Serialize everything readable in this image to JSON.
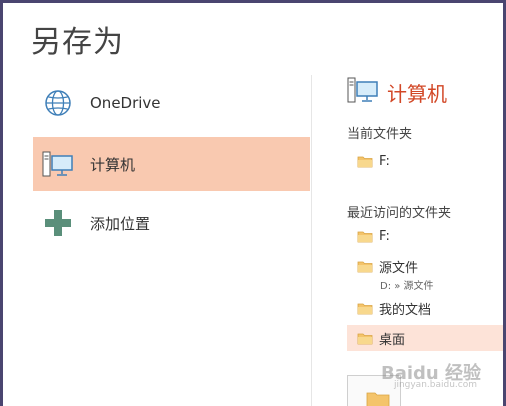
{
  "title": "另存为",
  "locations": [
    {
      "label": "OneDrive",
      "icon": "globe-icon"
    },
    {
      "label": "计算机",
      "icon": "computer-icon",
      "selected": true
    },
    {
      "label": "添加位置",
      "icon": "plus-icon"
    }
  ],
  "right": {
    "heading": "计算机",
    "current_folder_title": "当前文件夹",
    "current_folder": "F:",
    "recent_title": "最近访问的文件夹",
    "recent": [
      {
        "name": "F:"
      },
      {
        "name": "源文件",
        "path": "D: » 源文件"
      },
      {
        "name": "我的文档"
      },
      {
        "name": "桌面",
        "selected": true
      }
    ]
  },
  "watermark": {
    "text": "Baidu 经验",
    "sub": "jingyan.baidu.com"
  },
  "colors": {
    "accent": "#d24726",
    "selected": "#f9c9b0",
    "selected_light": "#fde3d8",
    "border": "#4a4570"
  }
}
